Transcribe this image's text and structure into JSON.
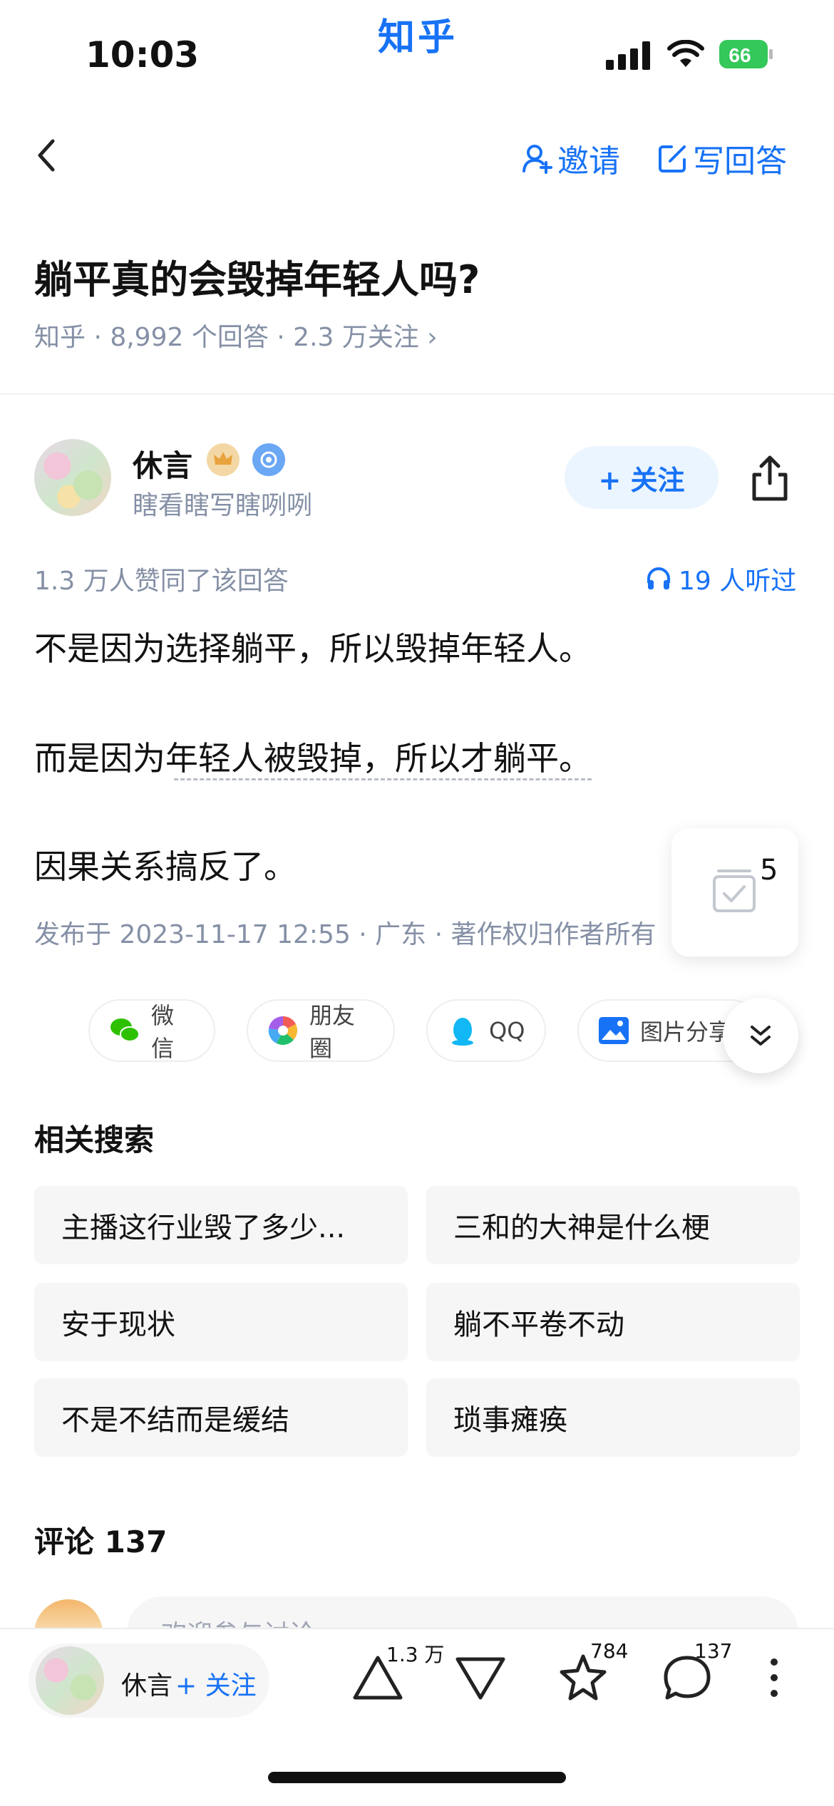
{
  "status_bar": {
    "time": "10:03",
    "app_brand": "知乎",
    "battery": "66"
  },
  "nav": {
    "invite_label": "邀请",
    "write_label": "写回答"
  },
  "question": {
    "title": "躺平真的会毁掉年轻人吗?",
    "meta": "知乎 · 8,992 个回答 · 2.3 万关注 ›"
  },
  "author": {
    "name": "休言",
    "bio": "瞎看瞎写瞎咧咧",
    "follow_label": "+ 关注"
  },
  "answer": {
    "likes_text": "1.3 万人赞同了该回答",
    "listen_text": "19 人听过",
    "paragraphs": [
      "不是因为选择躺平，所以毁掉年轻人。",
      "而是因为年轻人被毁掉，所以才躺平。",
      "因果关系搞反了。"
    ],
    "publish_info": "发布于 2023-11-17 12:55 · 广东 · 著作权归作者所有",
    "collect_count": "5"
  },
  "share": {
    "wechat": "微信",
    "moments": "朋友圈",
    "qq": "QQ",
    "image": "图片分享"
  },
  "related": {
    "title": "相关搜索",
    "items": [
      "主播这行业毁了多少...",
      "三和的大神是什么梗",
      "安于现状",
      "躺不平卷不动",
      "不是不结而是缓结",
      "琐事瘫痪"
    ]
  },
  "comments": {
    "title": "评论 137",
    "placeholder": "欢迎参与讨论"
  },
  "bottom_bar": {
    "author_name": "休言",
    "follow_label": "+ 关注",
    "upvote_count": "1.3 万",
    "favorite_count": "784",
    "comment_count": "137"
  },
  "colors": {
    "accent": "#1772f6",
    "muted": "#8590a6"
  }
}
